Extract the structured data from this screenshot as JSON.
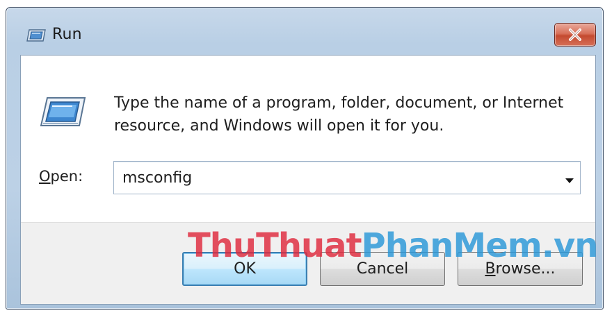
{
  "window": {
    "title": "Run",
    "close_icon": "close-x-icon"
  },
  "dialog": {
    "icon": "run-icon",
    "prompt_line1": "Type the name of a program, folder, document, or Internet",
    "prompt_line2": "resource, and Windows will open it for you.",
    "open_label_mnemonic": "O",
    "open_label_rest": "pen:",
    "open_value": "msconfig",
    "dropdown_icon": "chevron-down-icon"
  },
  "buttons": {
    "ok": "OK",
    "cancel": "Cancel",
    "browse_mnemonic": "B",
    "browse_rest": "rowse..."
  },
  "watermark": {
    "part1": "ThuThuat",
    "part2": "PhanMem.vn",
    "color1": "#de283c",
    "color2": "#2896d7"
  },
  "colors": {
    "title_bar": "#bcd1e6",
    "close_button": "#c44a30",
    "default_button_border": "#3c7fb1",
    "footer": "#f0f0f0"
  }
}
